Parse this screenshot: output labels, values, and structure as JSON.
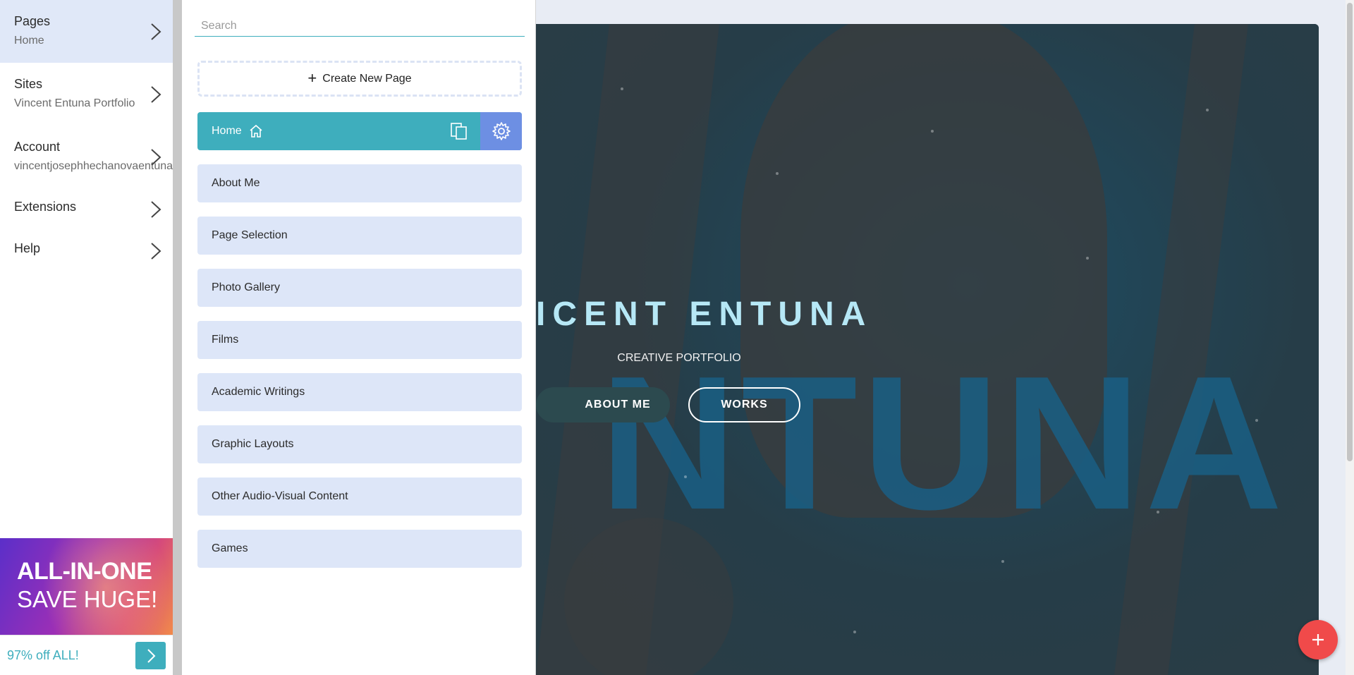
{
  "sidebar": {
    "items": [
      {
        "title": "Pages",
        "sub": "Home"
      },
      {
        "title": "Sites",
        "sub": "Vincent Entuna Portfolio"
      },
      {
        "title": "Account",
        "sub": "vincentjosephhechanovaentuna@g"
      },
      {
        "title": "Extensions"
      },
      {
        "title": "Help"
      }
    ]
  },
  "promo": {
    "line1": "ALL-IN-ONE",
    "line2": "SAVE HUGE!",
    "offer": "97% off ALL!"
  },
  "panel": {
    "search_placeholder": "Search",
    "create_label": "Create New Page",
    "pages": [
      {
        "label": "Home"
      },
      {
        "label": "About Me"
      },
      {
        "label": "Page Selection"
      },
      {
        "label": "Photo Gallery"
      },
      {
        "label": "Films"
      },
      {
        "label": "Academic Writings"
      },
      {
        "label": "Graphic Layouts"
      },
      {
        "label": "Other Audio-Visual Content"
      },
      {
        "label": "Games"
      }
    ]
  },
  "preview": {
    "hero_name": "ICENT ENTUNA",
    "hero_bg_text": "NTUNA",
    "hero_subtitle": "CREATIVE PORTFOLIO",
    "button_about": "ABOUT ME",
    "button_works": "WORKS"
  },
  "colors": {
    "accent": "#3eaebd",
    "gear_button": "#6d8fe3",
    "fab": "#f04a4a",
    "page_row": "#dde6f8"
  },
  "icons": {
    "home": "home-icon",
    "duplicate": "duplicate-icon",
    "settings": "gear-icon",
    "chevron": "chevron-right-icon",
    "add": "plus-icon"
  }
}
